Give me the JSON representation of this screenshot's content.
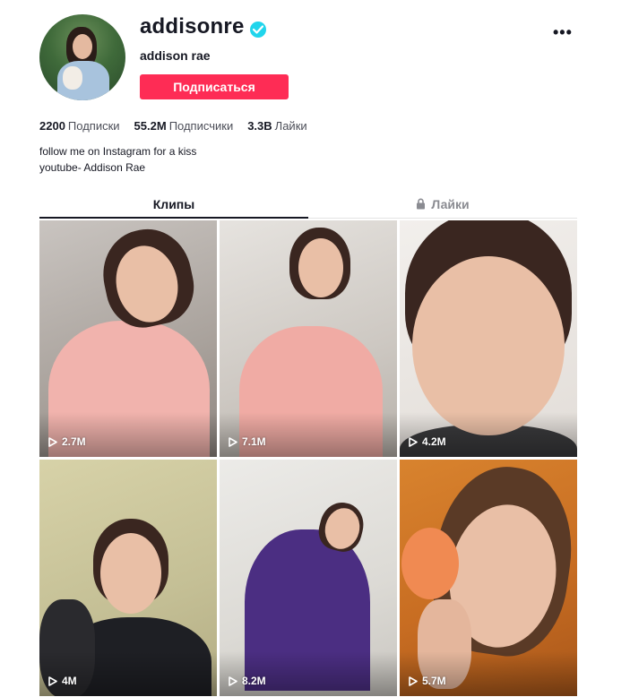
{
  "profile": {
    "username": "addisonre",
    "nickname": "addison rae",
    "follow_label": "Подписаться",
    "more_label": "•••",
    "verified_icon": "verified-check-icon"
  },
  "stats": {
    "following_value": "2200",
    "following_label": "Подписки",
    "followers_value": "55.2M",
    "followers_label": "Подписчики",
    "likes_value": "3.3B",
    "likes_label": "Лайки"
  },
  "bio": {
    "line1": "follow me on Instagram for a kiss",
    "line2": "youtube- Addison Rae"
  },
  "tabs": {
    "clips_label": "Клипы",
    "likes_label": "Лайки"
  },
  "videos": [
    {
      "views": "2.7M"
    },
    {
      "views": "7.1M"
    },
    {
      "views": "4.2M"
    },
    {
      "views": "4M"
    },
    {
      "views": "8.2M"
    },
    {
      "views": "5.7M"
    }
  ],
  "colors": {
    "accent": "#fe2c55",
    "verified": "#20d5ec",
    "text": "#161823"
  }
}
